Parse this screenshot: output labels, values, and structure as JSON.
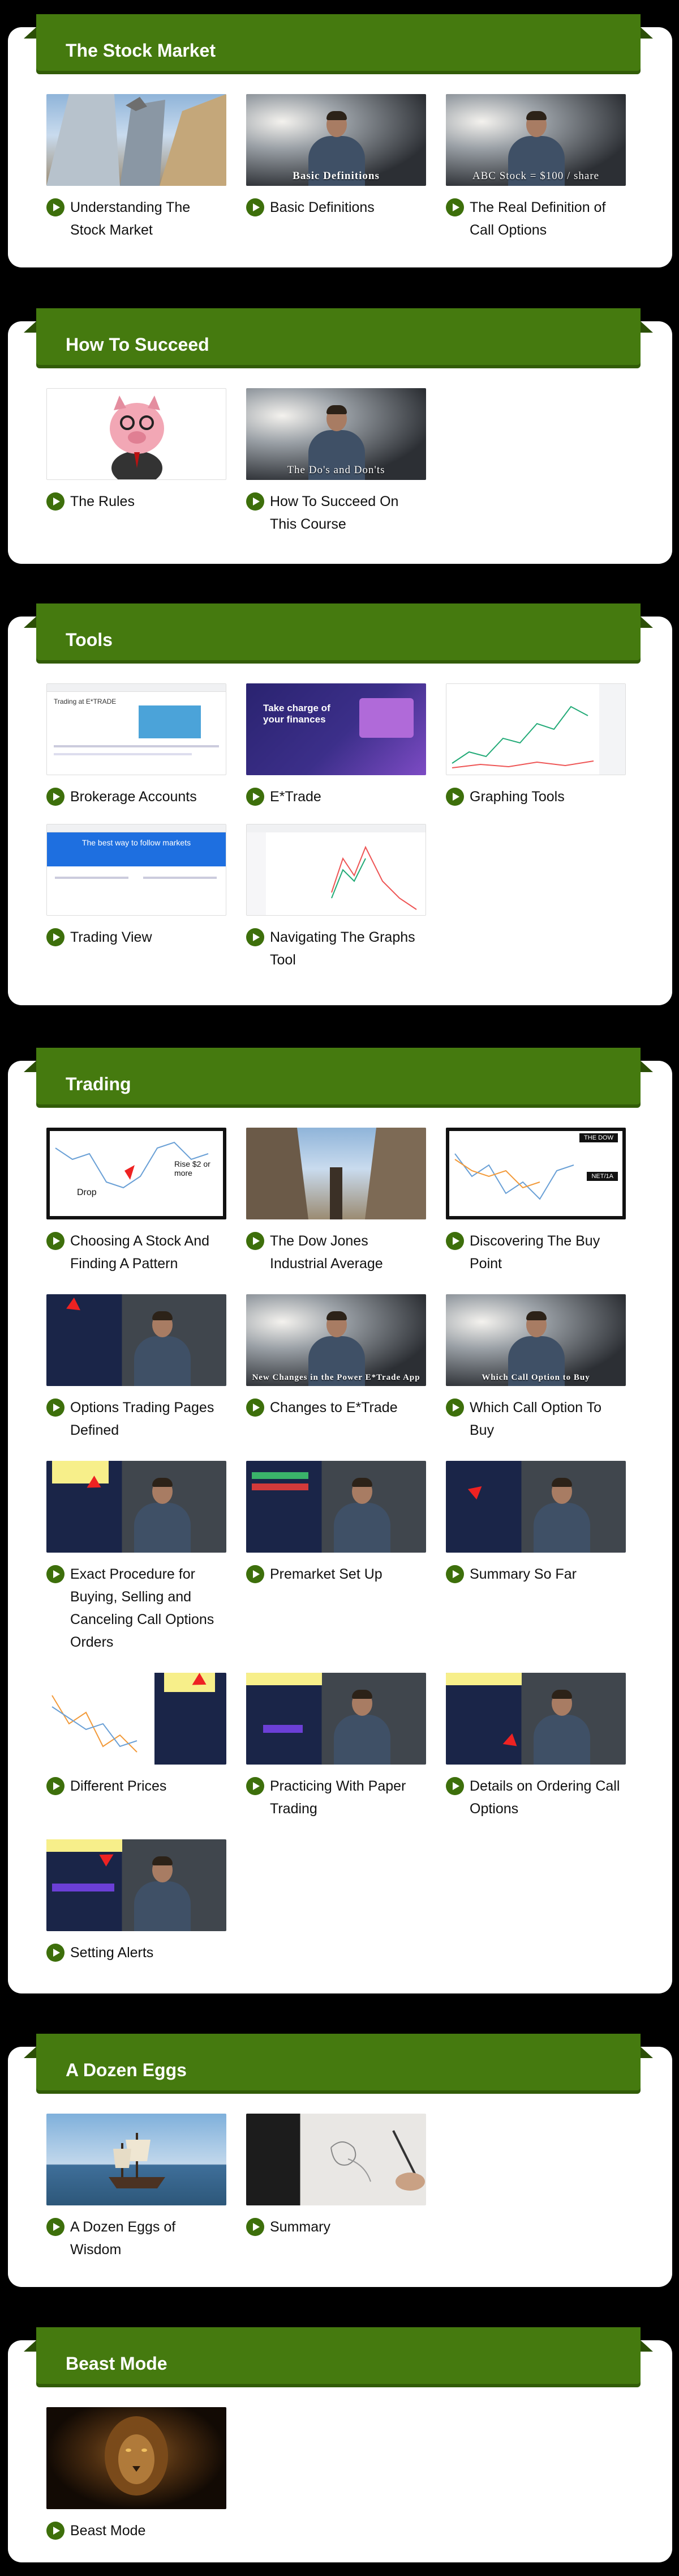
{
  "sections": [
    {
      "title": "The Stock Market",
      "lessons": [
        {
          "label": "Understanding The Stock Market",
          "thumb_caption": ""
        },
        {
          "label": "Basic Definitions",
          "thumb_caption": "Basic Definitions"
        },
        {
          "label": "The Real Definition of Call Options",
          "thumb_caption": "ABC Stock = $100 / share"
        }
      ]
    },
    {
      "title": "How To Succeed",
      "lessons": [
        {
          "label": "The Rules",
          "thumb_caption": ""
        },
        {
          "label": "How To Succeed On This Course",
          "thumb_caption": "The Do's and Don'ts"
        }
      ]
    },
    {
      "title": "Tools",
      "lessons": [
        {
          "label": "Brokerage Accounts",
          "thumb_caption": ""
        },
        {
          "label": "E*Trade",
          "thumb_caption": ""
        },
        {
          "label": "Graphing Tools",
          "thumb_caption": ""
        },
        {
          "label": "Trading View",
          "thumb_caption": ""
        },
        {
          "label": "Navigating The Graphs Tool",
          "thumb_caption": ""
        }
      ]
    },
    {
      "title": "Trading",
      "lessons": [
        {
          "label": "Choosing A Stock And Finding A Pattern",
          "thumb_caption": ""
        },
        {
          "label": "The Dow Jones Industrial Average",
          "thumb_caption": ""
        },
        {
          "label": "Discovering The Buy Point",
          "thumb_caption": ""
        },
        {
          "label": "Options Trading Pages Defined",
          "thumb_caption": ""
        },
        {
          "label": "Changes to E*Trade",
          "thumb_caption": "New Changes in the Power E*Trade App"
        },
        {
          "label": "Which Call Option To Buy",
          "thumb_caption": "Which Call Option to Buy"
        },
        {
          "label": "Exact Procedure for Buying, Selling and Canceling Call Options Orders",
          "thumb_caption": ""
        },
        {
          "label": "Premarket Set Up",
          "thumb_caption": ""
        },
        {
          "label": "Summary So Far",
          "thumb_caption": ""
        },
        {
          "label": "Different Prices",
          "thumb_caption": ""
        },
        {
          "label": "Practicing With Paper Trading",
          "thumb_caption": ""
        },
        {
          "label": "Details on Ordering Call Options",
          "thumb_caption": ""
        },
        {
          "label": "Setting Alerts",
          "thumb_caption": ""
        }
      ]
    },
    {
      "title": "A Dozen Eggs",
      "lessons": [
        {
          "label": "A Dozen Eggs of Wisdom",
          "thumb_caption": ""
        },
        {
          "label": "Summary",
          "thumb_caption": ""
        }
      ]
    },
    {
      "title": "Beast Mode",
      "lessons": [
        {
          "label": "Beast Mode",
          "thumb_caption": ""
        }
      ]
    }
  ],
  "thumb_text": {
    "chart_drop": "Drop",
    "chart_rise": "Rise $2 or more",
    "the_dow": "THE DOW",
    "dow_box": "NET/1A",
    "etrade_hero_1": "Trading at E*TRADE",
    "etrade_hero_2": "Take charge of your finances",
    "tradingview_hero": "The best way to follow markets"
  },
  "colors": {
    "banner": "#457a0f",
    "play_icon": "#3d6f0b",
    "page_bg": "#000000",
    "card_bg": "#ffffff"
  }
}
